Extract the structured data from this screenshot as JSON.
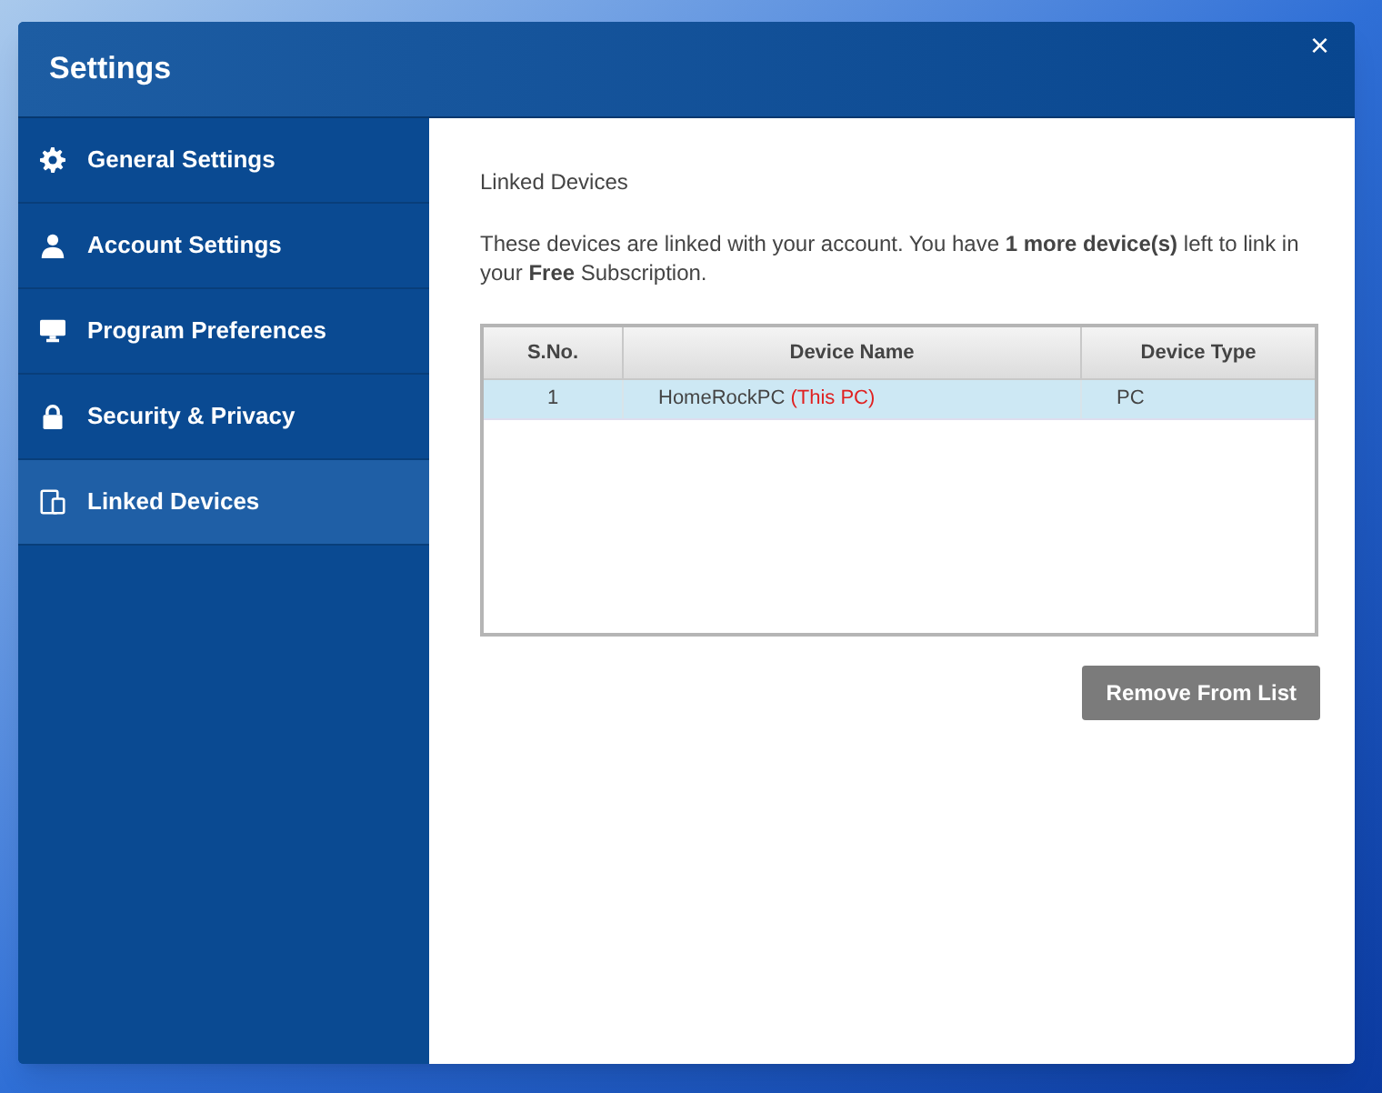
{
  "window": {
    "title": "Settings",
    "close": "×"
  },
  "sidebar": {
    "items": [
      {
        "label": "General Settings",
        "selected": false
      },
      {
        "label": "Account Settings",
        "selected": false
      },
      {
        "label": "Program Preferences",
        "selected": false
      },
      {
        "label": "Security & Privacy",
        "selected": false
      },
      {
        "label": "Linked Devices",
        "selected": true
      }
    ]
  },
  "content": {
    "heading": "Linked Devices",
    "description": "These devices are linked with your account. You have **1 more device(s)** left to link in your **Free** Subscription.",
    "table": {
      "columns": [
        "S.No.",
        "Device Name",
        "Device Type"
      ],
      "rows": [
        {
          "sno": "1",
          "name": "HomeRockPC",
          "tag": "(This PC)",
          "type": "PC",
          "selected": true
        }
      ]
    },
    "button": "Remove From List"
  }
}
